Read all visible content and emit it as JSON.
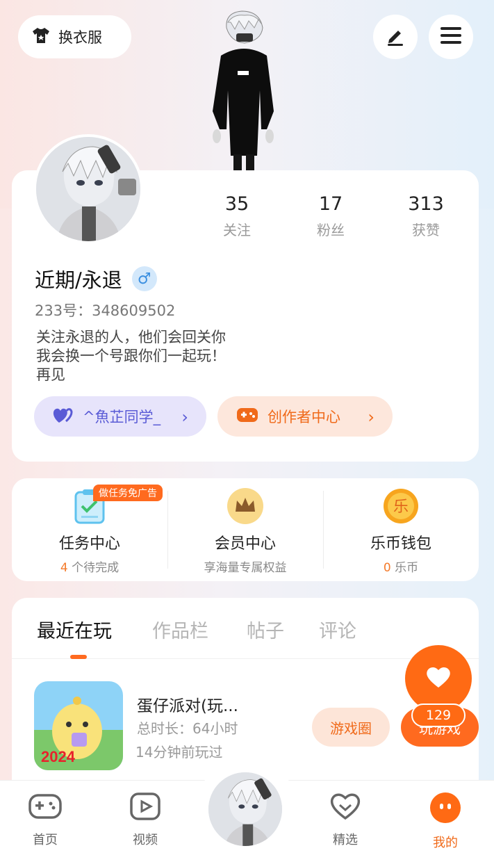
{
  "header": {
    "outfit_label": "换衣服"
  },
  "profile": {
    "stats": [
      {
        "num": "35",
        "label": "关注"
      },
      {
        "num": "17",
        "label": "粉丝"
      },
      {
        "num": "313",
        "label": "获赞"
      }
    ],
    "username": "近期/永退",
    "gender_symbol": "♂",
    "uid": "233号：348609502",
    "bio": "关注永退的人，他们会回关你\n我会换一个号跟你们一起玩！\n再见",
    "friend_pill": "^魚芷同学_",
    "creator_pill": "创作者中心"
  },
  "services": [
    {
      "title": "任务中心",
      "sub_hl": "4",
      "sub": "个待完成",
      "tag": "做任务免广告"
    },
    {
      "title": "会员中心",
      "sub_hl": "",
      "sub": "享海量专属权益",
      "tag": ""
    },
    {
      "title": "乐币钱包",
      "sub_hl": "0",
      "sub": "乐币",
      "tag": ""
    }
  ],
  "tabs": [
    "最近在玩",
    "作品栏",
    "帖子",
    "评论"
  ],
  "game": {
    "name": "蛋仔派对(玩...",
    "duration": "总时长：64小时",
    "last_played": "14分钟前玩过",
    "thumb_text": "2024",
    "btn_circle": "游戏圈",
    "btn_play": "玩游戏"
  },
  "like_count": "129",
  "nav": [
    {
      "label": "首页"
    },
    {
      "label": "视频"
    },
    {
      "label": "精选"
    },
    {
      "label": "我的"
    }
  ],
  "colors": {
    "accent": "#ff6a1f",
    "friend_pill_bg": "#e7e4fb",
    "creator_pill_bg": "#fde7dc"
  }
}
